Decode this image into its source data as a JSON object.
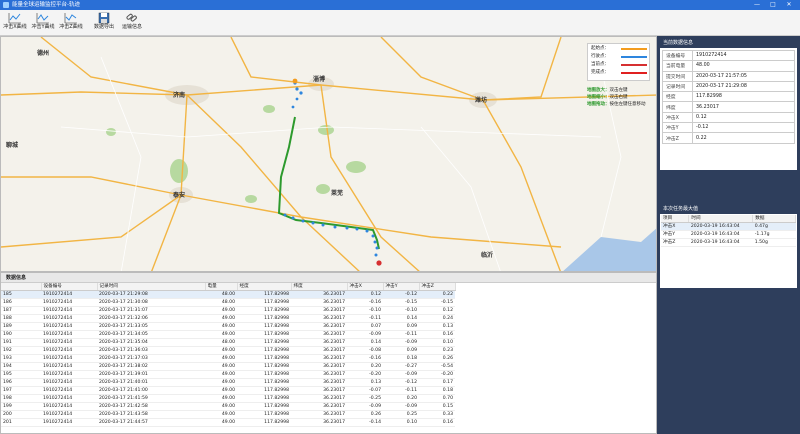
{
  "window": {
    "title": "能量全球运输监控平台-轨迹",
    "minimize": "—",
    "maximize": "□",
    "close": "✕"
  },
  "toolbar": {
    "items": [
      {
        "label": "冲击X曲线",
        "icon": "chart-line-icon"
      },
      {
        "label": "冲击Y曲线",
        "icon": "chart-line-icon"
      },
      {
        "label": "冲击Z曲线",
        "icon": "chart-line-icon"
      },
      {
        "label": "数据导出",
        "icon": "save-disk-icon"
      },
      {
        "label": "运输信息",
        "icon": "link-icon"
      }
    ]
  },
  "map": {
    "legend": [
      {
        "label": "起始点：",
        "color": "#f39c1e"
      },
      {
        "label": "行驶点：",
        "color": "#2e86de"
      },
      {
        "label": "当前点：",
        "color": "#d63031"
      },
      {
        "label": "完成点：",
        "color": "#e02020"
      }
    ],
    "hints": [
      {
        "key": "地图放大：",
        "value": "双击左键"
      },
      {
        "key": "地图缩小：",
        "value": "双击右键"
      },
      {
        "key": "地图拖动：",
        "value": "按住左键任意移动"
      }
    ],
    "cities": [
      "聊城",
      "济南",
      "淄博",
      "潍坊",
      "泰安",
      "莱芜",
      "德州",
      "临沂"
    ],
    "colors": {
      "route_green": "#2d9a2d",
      "route_blue": "#2e86de",
      "end_point": "#d63031",
      "water": "#a9c7e8"
    }
  },
  "data_panel": {
    "title": "数据信息",
    "columns": [
      "设备编号",
      "记录时间",
      "电量",
      "经度",
      "纬度",
      "冲击X",
      "冲击Y",
      "冲击Z"
    ],
    "rows": [
      {
        "idx": "185",
        "device": "1910272414",
        "time": "2020-03-17 21:29:08",
        "battery": "48.00",
        "lng": "117.82998",
        "lat": "36.23017",
        "x": "0.12",
        "y": "-0.12",
        "z": "0.22"
      },
      {
        "idx": "186",
        "device": "1910272414",
        "time": "2020-03-17 21:30:08",
        "battery": "48.00",
        "lng": "117.82998",
        "lat": "36.23017",
        "x": "-0.16",
        "y": "-0.15",
        "z": "-0.15"
      },
      {
        "idx": "187",
        "device": "1910272414",
        "time": "2020-03-17 21:31:07",
        "battery": "49.00",
        "lng": "117.82998",
        "lat": "36.23017",
        "x": "-0.10",
        "y": "-0.10",
        "z": "0.12"
      },
      {
        "idx": "188",
        "device": "1910272414",
        "time": "2020-03-17 21:32:06",
        "battery": "49.00",
        "lng": "117.82998",
        "lat": "36.23017",
        "x": "-0.11",
        "y": "0.14",
        "z": "0.24"
      },
      {
        "idx": "189",
        "device": "1910272414",
        "time": "2020-03-17 21:33:05",
        "battery": "49.00",
        "lng": "117.82998",
        "lat": "36.23017",
        "x": "0.07",
        "y": "0.09",
        "z": "0.13"
      },
      {
        "idx": "190",
        "device": "1910272414",
        "time": "2020-03-17 21:34:05",
        "battery": "49.00",
        "lng": "117.82998",
        "lat": "36.23017",
        "x": "-0.09",
        "y": "-0.11",
        "z": "0.16"
      },
      {
        "idx": "191",
        "device": "1910272414",
        "time": "2020-03-17 21:35:04",
        "battery": "48.00",
        "lng": "117.82998",
        "lat": "36.23017",
        "x": "0.14",
        "y": "-0.09",
        "z": "0.10"
      },
      {
        "idx": "192",
        "device": "1910272414",
        "time": "2020-03-17 21:36:03",
        "battery": "49.00",
        "lng": "117.82998",
        "lat": "36.23017",
        "x": "-0.08",
        "y": "0.09",
        "z": "0.23"
      },
      {
        "idx": "193",
        "device": "1910272414",
        "time": "2020-03-17 21:37:03",
        "battery": "49.00",
        "lng": "117.82998",
        "lat": "36.23017",
        "x": "-0.16",
        "y": "0.18",
        "z": "0.26"
      },
      {
        "idx": "194",
        "device": "1910272414",
        "time": "2020-03-17 21:38:02",
        "battery": "49.00",
        "lng": "117.82998",
        "lat": "36.23017",
        "x": "0.20",
        "y": "-0.27",
        "z": "-0.54"
      },
      {
        "idx": "195",
        "device": "1910272414",
        "time": "2020-03-17 21:39:01",
        "battery": "49.00",
        "lng": "117.82998",
        "lat": "36.23017",
        "x": "-0.20",
        "y": "-0.09",
        "z": "-0.20"
      },
      {
        "idx": "196",
        "device": "1910272414",
        "time": "2020-03-17 21:40:01",
        "battery": "49.00",
        "lng": "117.82998",
        "lat": "36.23017",
        "x": "0.13",
        "y": "-0.12",
        "z": "0.17"
      },
      {
        "idx": "197",
        "device": "1910272414",
        "time": "2020-03-17 21:41:00",
        "battery": "49.00",
        "lng": "117.82998",
        "lat": "36.23017",
        "x": "-0.07",
        "y": "-0.11",
        "z": "0.18"
      },
      {
        "idx": "198",
        "device": "1910272414",
        "time": "2020-03-17 21:41:59",
        "battery": "49.00",
        "lng": "117.82998",
        "lat": "36.23017",
        "x": "-0.25",
        "y": "0.20",
        "z": "0.70"
      },
      {
        "idx": "199",
        "device": "1910272414",
        "time": "2020-03-17 21:42:58",
        "battery": "49.00",
        "lng": "117.82998",
        "lat": "36.23017",
        "x": "-0.09",
        "y": "-0.09",
        "z": "0.15"
      },
      {
        "idx": "200",
        "device": "1910272414",
        "time": "2020-03-17 21:43:58",
        "battery": "49.00",
        "lng": "117.82998",
        "lat": "36.23017",
        "x": "0.26",
        "y": "0.25",
        "z": "0.33"
      },
      {
        "idx": "201",
        "device": "1910272414",
        "time": "2020-03-17 21:44:57",
        "battery": "49.00",
        "lng": "117.82998",
        "lat": "36.23017",
        "x": "-0.14",
        "y": "0.10",
        "z": "0.16"
      }
    ]
  },
  "current_panel": {
    "title": "当前数据信息",
    "rows": [
      {
        "key": "设备编号",
        "value": "1910272414"
      },
      {
        "key": "当前电量",
        "value": "48.00"
      },
      {
        "key": "提交时间",
        "value": "2020-03-17 21:57:05"
      },
      {
        "key": "记录时间",
        "value": "2020-03-17 21:29:08"
      },
      {
        "key": "经度",
        "value": "117.82998"
      },
      {
        "key": "纬度",
        "value": "36.23017"
      },
      {
        "key": "冲击X",
        "value": "0.12"
      },
      {
        "key": "冲击Y",
        "value": "-0.12"
      },
      {
        "key": "冲击Z",
        "value": "0.22"
      }
    ]
  },
  "max_panel": {
    "title": "本次任务最大值",
    "columns": [
      "项目",
      "时间",
      "数据"
    ],
    "rows": [
      {
        "item": "冲击X",
        "time": "2020-03-19 16:43:04",
        "value": "0.47g"
      },
      {
        "item": "冲击Y",
        "time": "2020-03-19 16:43:04",
        "value": "-1.17g"
      },
      {
        "item": "冲击Z",
        "time": "2020-03-19 16:43:04",
        "value": "1.50g"
      }
    ]
  }
}
